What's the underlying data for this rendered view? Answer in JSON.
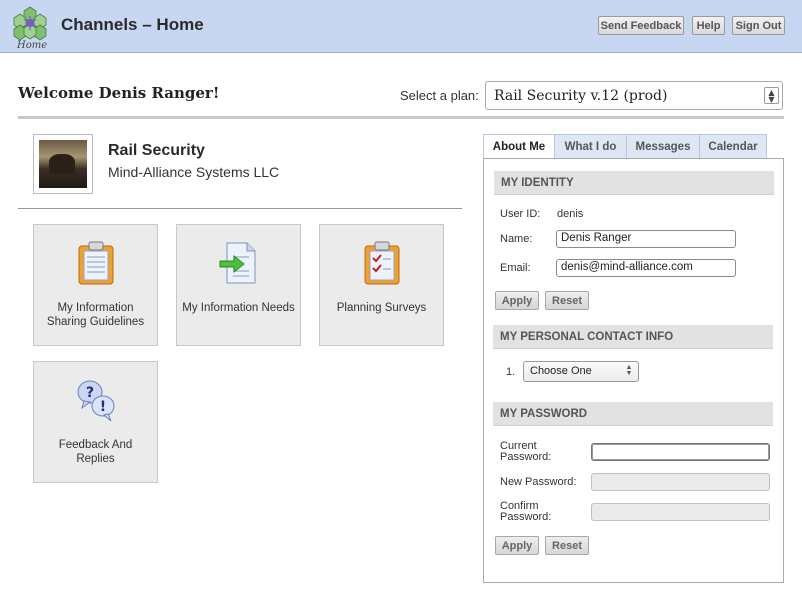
{
  "header": {
    "app_title": "Channels – Home",
    "logo_label": "Home",
    "buttons": {
      "feedback": "Send Feedback",
      "help": "Help",
      "signout": "Sign Out"
    }
  },
  "welcome": {
    "text": "Welcome Denis Ranger!",
    "plan_label": "Select a plan:",
    "plan_selected": "Rail Security v.12 (prod)"
  },
  "plan": {
    "name": "Rail Security",
    "organization": "Mind-Alliance Systems LLC"
  },
  "tiles": [
    {
      "label": "My Information Sharing Guidelines"
    },
    {
      "label": "My Information Needs"
    },
    {
      "label": "Planning Surveys"
    },
    {
      "label": "Feedback And Replies"
    }
  ],
  "tabs": [
    "About Me",
    "What I do",
    "Messages",
    "Calendar"
  ],
  "identity": {
    "heading": "MY IDENTITY",
    "userid_label": "User ID:",
    "userid_value": "denis",
    "name_label": "Name:",
    "name_value": "Denis Ranger",
    "email_label": "Email:",
    "email_value": "denis@mind-alliance.com",
    "apply": "Apply",
    "reset": "Reset"
  },
  "contact": {
    "heading": "MY PERSONAL CONTACT INFO",
    "index": "1.",
    "select_value": "Choose One"
  },
  "password": {
    "heading": "MY PASSWORD",
    "current_label": "Current Password:",
    "new_label": "New Password:",
    "confirm_label": "Confirm Password:",
    "apply": "Apply",
    "reset": "Reset"
  }
}
